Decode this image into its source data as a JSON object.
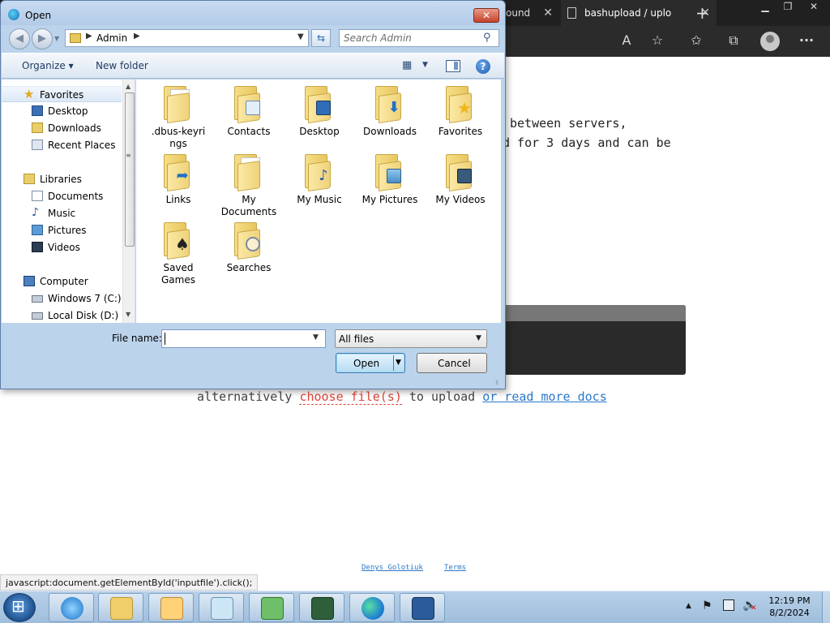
{
  "browser": {
    "tabs": [
      {
        "label": "ound"
      },
      {
        "label": "bashupload / uplo"
      }
    ],
    "new_tab_label": "+",
    "window_controls": {
      "minimize": "▁",
      "maximize": "❐",
      "close": "✕"
    },
    "toolbar_icons": [
      "read-aloud-icon",
      "add-favorite-icon",
      "favorites-icon",
      "collections-icon",
      "profile-avatar",
      "more-icon"
    ],
    "more_label": "···"
  },
  "page": {
    "line1": "between servers,",
    "line2": "d for 3 days and can be",
    "alt_prefix": "alternatively ",
    "choose_link": "choose file(s)",
    "alt_middle": " to upload ",
    "docs_link": "or read more docs",
    "footer_author": "Denys Golotiuk",
    "footer_terms": "Terms",
    "status_url": "javascript:document.getElementById('inputfile').click();"
  },
  "dialog": {
    "title": "Open",
    "close_label": "✕",
    "address_crumb": "Admin",
    "search_placeholder": "Search Admin",
    "organize_label": "Organize ▾",
    "new_folder_label": "New folder",
    "help_label": "?",
    "nav": [
      {
        "label": "Favorites",
        "icon": "star-icon"
      },
      {
        "label": "Desktop",
        "icon": "desktop-icon"
      },
      {
        "label": "Downloads",
        "icon": "downloads-icon"
      },
      {
        "label": "Recent Places",
        "icon": "recent-places-icon"
      },
      {
        "label": "Libraries",
        "icon": "libraries-icon"
      },
      {
        "label": "Documents",
        "icon": "documents-icon"
      },
      {
        "label": "Music",
        "icon": "music-icon"
      },
      {
        "label": "Pictures",
        "icon": "pictures-icon"
      },
      {
        "label": "Videos",
        "icon": "videos-icon"
      },
      {
        "label": "Computer",
        "icon": "computer-icon"
      },
      {
        "label": "Windows 7 (C:)",
        "icon": "drive-icon"
      },
      {
        "label": "Local Disk (D:)",
        "icon": "drive-icon"
      }
    ],
    "files": [
      {
        "name": ".dbus-keyri",
        "name2": "ngs"
      },
      {
        "name": "Contacts",
        "name2": ""
      },
      {
        "name": "Desktop",
        "name2": ""
      },
      {
        "name": "Downloads",
        "name2": ""
      },
      {
        "name": "Favorites",
        "name2": ""
      },
      {
        "name": "Links",
        "name2": ""
      },
      {
        "name": "My",
        "name2": "Documents"
      },
      {
        "name": "My Music",
        "name2": ""
      },
      {
        "name": "My Pictures",
        "name2": ""
      },
      {
        "name": "My Videos",
        "name2": ""
      },
      {
        "name": "Saved",
        "name2": "Games"
      },
      {
        "name": "Searches",
        "name2": ""
      }
    ],
    "filename_label": "File name:",
    "filename_value": "",
    "filter_label": "All files",
    "open_label": "Open",
    "cancel_label": "Cancel"
  },
  "taskbar": {
    "apps": [
      "internet-explorer",
      "windows-explorer",
      "media-player",
      "notepad",
      "network-app",
      "task-manager",
      "edge",
      "app"
    ],
    "clock_time": "12:19 PM",
    "clock_date": "8/2/2024"
  },
  "colors": {
    "link_red": "#e0453a",
    "link_blue": "#2a78c8",
    "browser_dark": "#202020"
  }
}
